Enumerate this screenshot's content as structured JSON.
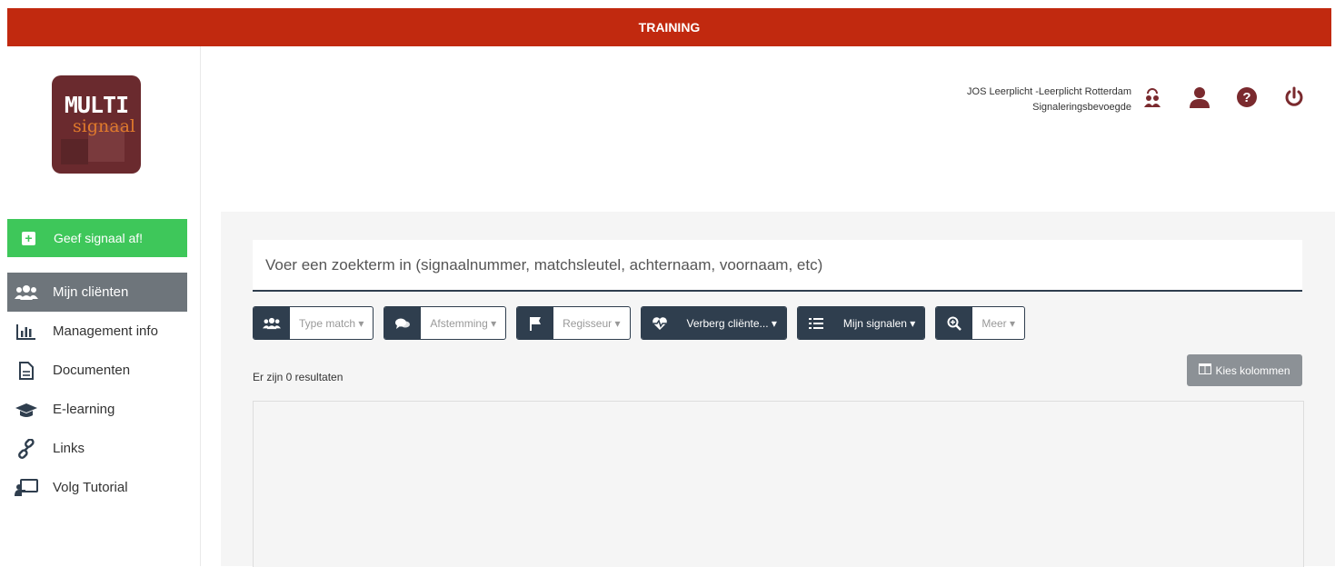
{
  "topbar": {
    "title": "TRAINING"
  },
  "logo": {
    "line1": "MULTI",
    "line2": "signaal"
  },
  "sidebar": {
    "cta_label": "Geef signaal af!",
    "items": [
      {
        "label": "Mijn cliënten",
        "icon": "users-icon",
        "active": true
      },
      {
        "label": "Management info",
        "icon": "bar-chart-icon",
        "active": false
      },
      {
        "label": "Documenten",
        "icon": "document-icon",
        "active": false
      },
      {
        "label": "E-learning",
        "icon": "graduation-cap-icon",
        "active": false
      },
      {
        "label": "Links",
        "icon": "link-icon",
        "active": false
      },
      {
        "label": "Volg Tutorial",
        "icon": "tutorial-icon",
        "active": false
      }
    ]
  },
  "header": {
    "organisation": "JOS Leerplicht -Leerplicht Rotterdam",
    "role": "Signaleringsbevoegde",
    "icons": [
      "role-switch-icon",
      "user-icon",
      "help-icon",
      "power-icon"
    ]
  },
  "search": {
    "placeholder": "Voer een zoekterm in (signaalnummer, matchsleutel, achternaam, voornaam, etc)"
  },
  "filters": [
    {
      "label": "Type match",
      "icon": "users-icon"
    },
    {
      "label": "Afstemming",
      "icon": "comments-icon"
    },
    {
      "label": "Regisseur",
      "icon": "flag-icon"
    },
    {
      "label": "Verberg cliënte...",
      "icon": "heartbeat-icon"
    },
    {
      "label": "Mijn signalen",
      "icon": "list-icon"
    },
    {
      "label": "Meer",
      "icon": "zoom-icon"
    }
  ],
  "results_text": "Er zijn 0 resultaten",
  "columns_button": "Kies kolommen",
  "colors": {
    "brand": "#c1290f",
    "cta": "#3ec75a",
    "dark": "#2f3e4e",
    "accent": "#7a2a2e"
  }
}
